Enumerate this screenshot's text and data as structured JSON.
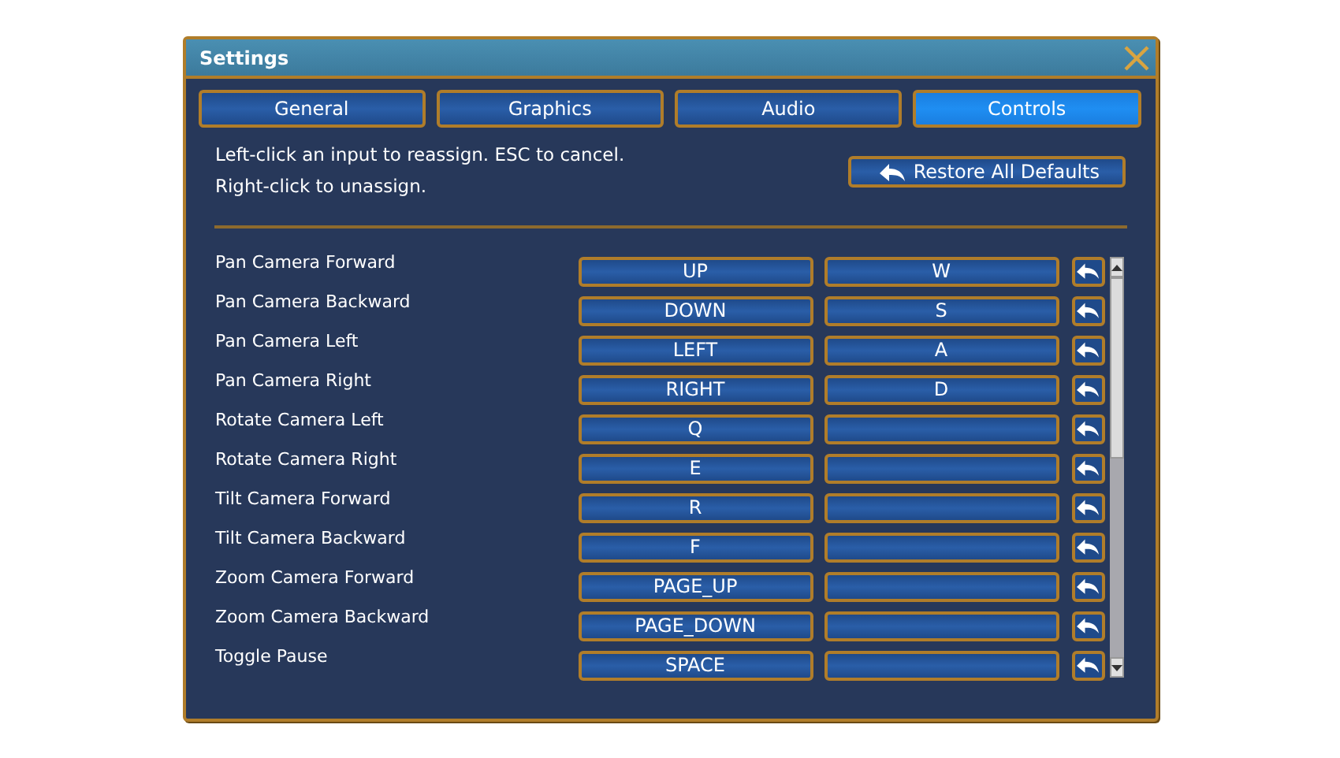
{
  "window": {
    "title": "Settings"
  },
  "tabs": [
    {
      "label": "General",
      "selected": false
    },
    {
      "label": "Graphics",
      "selected": false
    },
    {
      "label": "Audio",
      "selected": false
    },
    {
      "label": "Controls",
      "selected": true
    }
  ],
  "instructions": [
    "Left-click an input to reassign. ESC to cancel.",
    "Right-click to unassign."
  ],
  "restore_button": {
    "label": "Restore All Defaults"
  },
  "bindings": [
    {
      "action": "Pan Camera Forward",
      "primary": "UP",
      "secondary": "W"
    },
    {
      "action": "Pan Camera Backward",
      "primary": "DOWN",
      "secondary": "S"
    },
    {
      "action": "Pan Camera Left",
      "primary": "LEFT",
      "secondary": "A"
    },
    {
      "action": "Pan Camera Right",
      "primary": "RIGHT",
      "secondary": "D"
    },
    {
      "action": "Rotate Camera Left",
      "primary": "Q"
    },
    {
      "action": "Rotate Camera Right",
      "primary": "E"
    },
    {
      "action": "Tilt Camera Forward",
      "primary": "R"
    },
    {
      "action": "Tilt Camera Backward",
      "primary": "F"
    },
    {
      "action": "Zoom Camera Forward",
      "primary": "PAGE_UP"
    },
    {
      "action": "Zoom Camera Backward",
      "primary": "PAGE_DOWN"
    },
    {
      "action": "Toggle Pause",
      "primary": "SPACE"
    }
  ]
}
